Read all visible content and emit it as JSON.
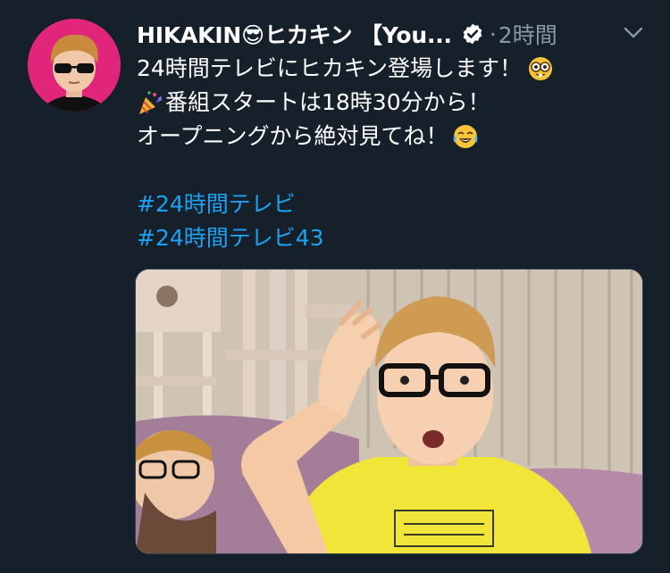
{
  "tweet": {
    "author": {
      "display_name": "HIKAKIN😎ヒカキン 【You...",
      "verified": true,
      "avatar": "avatar-photo"
    },
    "separator": "·",
    "time": "2時間",
    "menu_icon": "chevron-down-icon",
    "lines": [
      "24時間テレビにヒカキン登場します！",
      "番組スタートは18時30分から！",
      "オープニングから絶対見てね！"
    ],
    "hashtags": [
      "#24時間テレビ",
      "#24時間テレビ43"
    ],
    "media": {
      "kind": "photo",
      "description_icon": "selfie-photo"
    }
  },
  "colors": {
    "background": "#15202b",
    "text": "#ffffff",
    "secondary_text": "#8899a6",
    "link": "#1da1f2",
    "avatar_bg": "#e0257a"
  }
}
